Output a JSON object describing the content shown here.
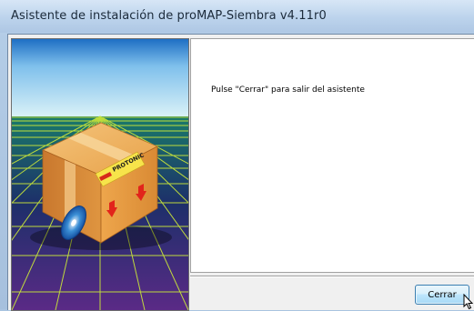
{
  "window": {
    "title": "Asistente de instalación de proMAP-Siembra v4.11r0"
  },
  "banner": {
    "logo_text": "PROTONIC",
    "icons": [
      "box-icon",
      "cd-icon",
      "arrow-up-icon"
    ]
  },
  "content": {
    "message": "Pulse \"Cerrar\" para salir del asistente"
  },
  "buttons": {
    "close_label": "Cerrar"
  },
  "colors": {
    "grid": "#c7e33a",
    "sky_top": "#2a7fd0",
    "box": "#e7a54a",
    "button_border": "#3c7fb1"
  }
}
